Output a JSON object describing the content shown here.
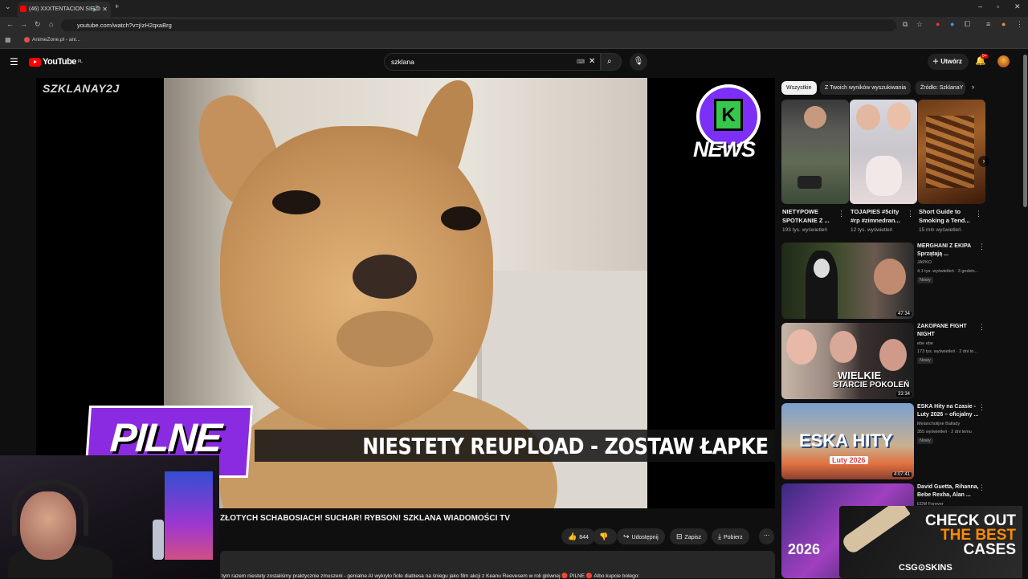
{
  "browser": {
    "tab_title": "(46) XXXTENTACION SIĘ O",
    "url": "youtube.com/watch?v=jIzH2qxaBrg",
    "bookmark": "AnimeZone.pl - ani..."
  },
  "header": {
    "logo_text": "YouTube",
    "logo_region": "PL",
    "search_value": "szklana",
    "create_label": "Utwórz",
    "notif_badge": "9+"
  },
  "player": {
    "channel_watermark": "SZKLANAY2J",
    "news_logo": "NEWS",
    "banner_text": "NIESTETY REUPLOAD - ZOSTAW ŁAPKE",
    "pilne_text": "PILNE"
  },
  "video": {
    "title": "ZŁOTYCH SCHABOSIACH! SUCHAR! RYBSON! SZKLANA WIADOMOŚCI TV",
    "likes": "844",
    "share": "Udostępnij",
    "save": "Zapisz",
    "download": "Pobierz",
    "description_snippet": "tym razem niestety zostaliśmy praktycznie zmuszeni - genialne AI wykryło fiole diablesa na śniegu jako film akcji z Keanu Reevesem w roli głównej 🔴 PILNE 🔴 Albo kupcie bolego:"
  },
  "sidebar": {
    "chips": [
      "Wszystkie",
      "Z Twoich wyników wyszukiwania",
      "Źródło: SzklanaY"
    ],
    "shorts": [
      {
        "title": "NIETYPOWE SPOTKANIE Z ...",
        "views": "193 tys. wyświetleń"
      },
      {
        "title": "TOJAPIES #5city #rp #zimnedran...",
        "views": "12 tys. wyświetleń"
      },
      {
        "title": "Short Guide to Smoking a Tend...",
        "views": "15 mln wyświetleń"
      }
    ],
    "videos": [
      {
        "title": "MERGHANI Z EKIPA Sprzątają ...",
        "channel": "JAPKO",
        "meta": "4,1 tys. wyświetleń · 3 godzin...",
        "badge": "Nowy",
        "duration": "47:34"
      },
      {
        "title": "ZAKOPANE FIGHT NIGHT",
        "channel": "ebe ebe",
        "meta": "173 tys. wyświetleń · 2 dni te...",
        "badge": "Nowy",
        "duration": "33:34",
        "thumb_text_1": "WIELKIE",
        "thumb_text_2": "STARCIE POKOLEŃ"
      },
      {
        "title": "ESKA Hity na Czasie - Luty 2026 – oficjalny ...",
        "channel": "Melancholijne Ballady",
        "meta": "355 wyświetleń · 2 dni temu",
        "badge": "Nowy",
        "duration": "4:07:41",
        "thumb_text_1": "ESKA HITY",
        "thumb_text_2": "Luty 2026"
      },
      {
        "title": "David Guetta, Rihanna, Bebe Rexha, Alan ...",
        "channel": "EDM Forever",
        "thumb_text_1": "2026"
      }
    ],
    "ad": {
      "line1": "CHECK OUT",
      "line2": "THE BEST",
      "line3": "CASES",
      "brand": "CSG⊙SKINS"
    }
  }
}
